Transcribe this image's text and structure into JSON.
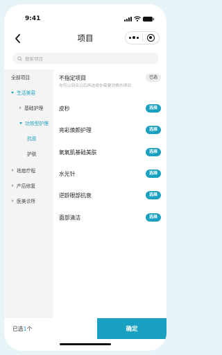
{
  "status": {
    "time": "9:41"
  },
  "nav": {
    "title": "项目"
  },
  "search": {
    "placeholder": "搜索项目"
  },
  "sidebar": {
    "items": [
      {
        "label": "全部项目"
      },
      {
        "label": "生活美容"
      },
      {
        "label": "基础护理"
      },
      {
        "label": "功效型护理"
      },
      {
        "label": "抗衰"
      },
      {
        "label": "护肤"
      },
      {
        "label": "祛痘疗程"
      },
      {
        "label": "产后修复"
      },
      {
        "label": "医美诊所"
      }
    ]
  },
  "content": {
    "unspecified": {
      "name": "不指定项目",
      "badge": "已选",
      "hint": "你可以到店以后再选择你需要消费的项目"
    },
    "select_label": "选择",
    "items": [
      {
        "name": "皮秒"
      },
      {
        "name": "亮彩焕颜护理"
      },
      {
        "name": "氧氧肌基础美肤"
      },
      {
        "name": "水光针"
      },
      {
        "name": "逆龄眼部抗衰"
      },
      {
        "name": "面部清洁"
      }
    ]
  },
  "bottom": {
    "selected_prefix": "已选",
    "selected_count": "1",
    "selected_suffix": "个",
    "confirm_label": "确定"
  },
  "colors": {
    "accent": "#1aa0c0",
    "sidebar_bg": "#f4f4f4",
    "page_bg": "#e6f4f8"
  }
}
